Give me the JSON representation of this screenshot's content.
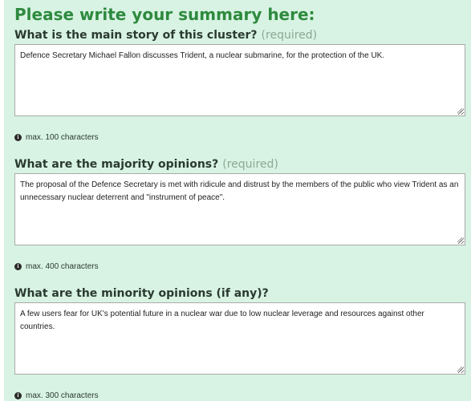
{
  "form": {
    "title": "Please write your summary here:",
    "required_tag": "(required)",
    "questions": [
      {
        "label": "What is the main story of this cluster?",
        "required": true,
        "answer": "Defence Secretary Michael Fallon discusses Trident, a nuclear submarine, for the protection of the UK.",
        "hint": "max. 100 characters"
      },
      {
        "label": "What are the majority opinions?",
        "required": true,
        "answer": "The proposal of the Defence Secretary is met with ridicule and distrust by the members of the public who view Trident as an unnecessary nuclear deterrent and \"instrument of peace\".",
        "hint": "max. 400 characters"
      },
      {
        "label": "What are the minority opinions (if any)?",
        "required": false,
        "answer": "A few users fear for UK's potential future in a nuclear war due to low nuclear leverage and resources against other countries.",
        "hint": "max. 300 characters"
      }
    ]
  },
  "colors": {
    "panel_background": "#d8f3e3",
    "title": "#2e8a3e",
    "label": "#2b3a2f",
    "required_tag": "#8fa796"
  },
  "icons": {
    "hint": "info-icon",
    "textarea_corner": "resize-grip-icon"
  }
}
